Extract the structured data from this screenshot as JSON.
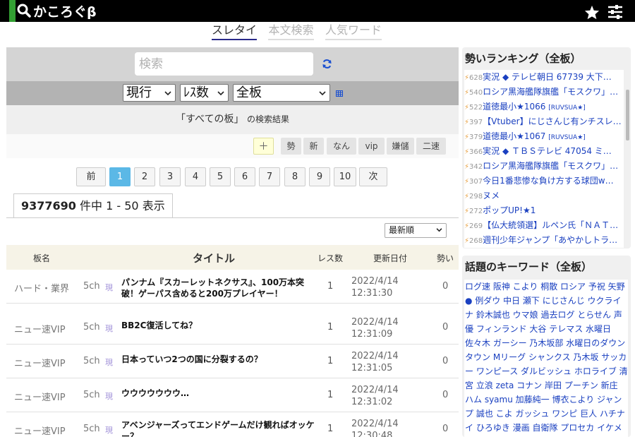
{
  "header": {
    "logo_text": "かころぐβ",
    "search_icon": "search-icon",
    "star_icon": "star-icon",
    "menu_icon": "settings-sliders-icon"
  },
  "tabs": [
    {
      "label": "スレタイ",
      "active": true
    },
    {
      "label": "本文検索",
      "active": false
    },
    {
      "label": "人気ワード",
      "active": false
    }
  ],
  "search": {
    "placeholder": "検索"
  },
  "filters": {
    "period": "現行",
    "sort_key": "ﾚｽ数",
    "board": "全板"
  },
  "result_header": {
    "board_quoted": "「すべての板」",
    "suffix": "の検索結果"
  },
  "filter_buttons": {
    "plus": "＋",
    "items": [
      "勢",
      "新",
      "なん",
      "vip",
      "嫌儲",
      "二速"
    ]
  },
  "pagination": {
    "prev": "前",
    "pages": [
      "1",
      "2",
      "3",
      "4",
      "5",
      "6",
      "7",
      "8",
      "9",
      "10"
    ],
    "current": "1",
    "next": "次"
  },
  "count": {
    "total": "9377690",
    "suffix": "件中 1 - 50 表示"
  },
  "sort": {
    "selected": "最新順"
  },
  "table": {
    "headers": {
      "board": "板名",
      "title": "タイトル",
      "res": "レス数",
      "date": "更新日付",
      "ikioi": "勢い"
    },
    "rows": [
      {
        "board": "ハード・業界",
        "src": "5ch",
        "now": "現",
        "title": "パンナム『スカーレットネクサス』、100万本突破！ゲーパス含めると200万プレイヤー！",
        "res": "1",
        "date": "2022/4/14",
        "time": "12:31:30",
        "ikioi": "0"
      },
      {
        "board": "ニュー速VIP",
        "src": "5ch",
        "now": "現",
        "title": "BB2C復活してね？",
        "res": "1",
        "date": "2022/4/14",
        "time": "12:31:09",
        "ikioi": "0"
      },
      {
        "board": "ニュー速VIP",
        "src": "5ch",
        "now": "現",
        "title": "日本っていつ2つの国に分裂するの？",
        "res": "1",
        "date": "2022/4/14",
        "time": "12:31:05",
        "ikioi": "0"
      },
      {
        "board": "ニュー速VIP",
        "src": "5ch",
        "now": "現",
        "title": "ウウウウウウウ…",
        "res": "1",
        "date": "2022/4/14",
        "time": "12:31:02",
        "ikioi": "0"
      },
      {
        "board": "ニュー速VIP",
        "src": "5ch",
        "now": "現",
        "title": "アベンジャーズってエンドゲームだけ観ればオッケー？",
        "res": "1",
        "date": "2022/4/14",
        "time": "12:30:48",
        "ikioi": "0"
      }
    ]
  },
  "ranking": {
    "title": "勢いランキング（全板）",
    "items": [
      {
        "n": "628",
        "t": "実況 ◆ テレビ朝日 67739 大下…",
        "tag": ""
      },
      {
        "n": "540",
        "t": "ロシア黒海艦隊旗艦「モスクワ」…",
        "tag": ""
      },
      {
        "n": "522",
        "t": "道徳最小★1066 ",
        "tag": "[RUVSUA★]"
      },
      {
        "n": "397",
        "t": "【Vtuber】にじさんじ有ンチスレ…",
        "tag": ""
      },
      {
        "n": "379",
        "t": "道徳最小★1067 ",
        "tag": "[RUVSUA★]"
      },
      {
        "n": "366",
        "t": "実況 ◆ ＴＢＳテレビ 47054 ミ…",
        "tag": ""
      },
      {
        "n": "342",
        "t": "ロシア黒海艦隊旗艦「モスクワ」…",
        "tag": ""
      },
      {
        "n": "307",
        "t": "今日1番悲惨な負け方する球団w…",
        "tag": ""
      },
      {
        "n": "298",
        "t": "ヌメ",
        "tag": ""
      },
      {
        "n": "272",
        "t": "ポップUP!★1",
        "tag": ""
      },
      {
        "n": "269",
        "t": "【仏大統領選】ルペン氏「ＮＡＴ…",
        "tag": ""
      },
      {
        "n": "268",
        "t": "週刊少年ジャンプ「あやかしトラ…",
        "tag": ""
      }
    ]
  },
  "keywords": {
    "title": "話題のキーワード（全板）",
    "text": "ログ速 阪神 こより 桐散 ロシア 予祝 矢野 ● 例ダウ 中日 瀬下 にじさんじ ウクライナ 鈴木誠也 ウマ娘 過去ログ とらせん 声優 フィンランド 大谷 テレマス 水曜日 佐々木 ガーシー 乃木坂部 水曜日のダウンタウン Mリーグ シャンクス 乃木坂 サッカー ワンピース ダルビッシュ ホロライブ 清宮 立浪 zeta コナン 岸田 プーチン 新庄 ハム syamu 加藤純一 博衣こより ジャンプ 誠也 こよ ガッシュ ワンピ 巨人 ハチナイ ひろゆき 漫画 自衛隊 プロセカ イケメン白"
  }
}
